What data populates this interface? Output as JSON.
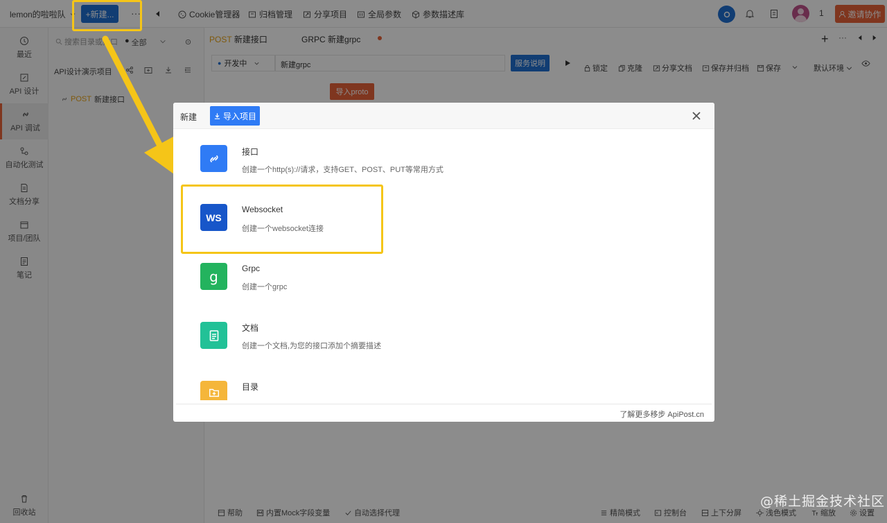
{
  "topbar": {
    "team_label": "lemon的啦啦队",
    "new_label": "+新建...",
    "more_label": "···",
    "nav": [
      "Cookie管理器",
      "归档管理",
      "分享项目",
      "全局参数",
      "参数描述库"
    ],
    "user_count": "1",
    "invite_label": "邀请协作"
  },
  "sidebar": {
    "items": [
      {
        "label": "最近",
        "icon": "clock-icon"
      },
      {
        "label": "API 设计",
        "icon": "edit-icon"
      },
      {
        "label": "API 调试",
        "icon": "link-icon"
      },
      {
        "label": "自动化测试",
        "icon": "flow-icon"
      },
      {
        "label": "文档分享",
        "icon": "doc-icon"
      },
      {
        "label": "项目/团队",
        "icon": "folder-icon"
      },
      {
        "label": "笔记",
        "icon": "note-icon"
      }
    ],
    "trash_label": "回收站"
  },
  "tree": {
    "search_placeholder": "搜索目录或接口",
    "filter_label": "全部",
    "project_name": "API设计演示项目",
    "items": [
      {
        "method": "POST",
        "name": "新建接口"
      }
    ]
  },
  "workspace": {
    "tabs": [
      {
        "method": "POST",
        "name": "新建接口"
      },
      {
        "method": "GRPC",
        "name": "新建grpc"
      }
    ],
    "env_status": "开发中",
    "url_value": "新建grpc",
    "service_btn": "服务说明",
    "tools": [
      "锁定",
      "克隆",
      "分享文档",
      "保存并归档",
      "保存"
    ],
    "env_select": "默认环境",
    "import_proto": "导入proto"
  },
  "modal": {
    "title": "新建",
    "import_label": "导入项目",
    "options": [
      {
        "title": "接口",
        "desc": "创建一个http(s)://请求，支持GET、POST、PUT等常用方式",
        "icon": "link-icon",
        "color": "#2f7bf5",
        "glyph": ""
      },
      {
        "title": "Websocket",
        "desc": "创建一个websocket连接",
        "icon": "ws-icon",
        "color": "#1756c9",
        "glyph": "WS"
      },
      {
        "title": "Grpc",
        "desc": "创建一个grpc",
        "icon": "grpc-icon",
        "color": "#23b35e",
        "glyph": "g"
      },
      {
        "title": "文档",
        "desc": "创建一个文档,为您的接口添加个摘要描述",
        "icon": "document-icon",
        "color": "#22c197",
        "glyph": ""
      },
      {
        "title": "目录",
        "desc": "",
        "icon": "folder-add-icon",
        "color": "#f5b63a",
        "glyph": ""
      }
    ],
    "footer": "了解更多移步 ApiPost.cn"
  },
  "statusbar": {
    "left": [
      "帮助",
      "内置Mock字段变量",
      "自动选择代理"
    ],
    "right": [
      "精简模式",
      "控制台",
      "上下分屏",
      "浅色模式",
      "缩放",
      "设置"
    ]
  },
  "watermark": "@稀土掘金技术社区",
  "colors": {
    "accent": "#1f6fd1",
    "invite": "#e8633a",
    "highlight": "#f5c518",
    "post": "#e8a317"
  }
}
